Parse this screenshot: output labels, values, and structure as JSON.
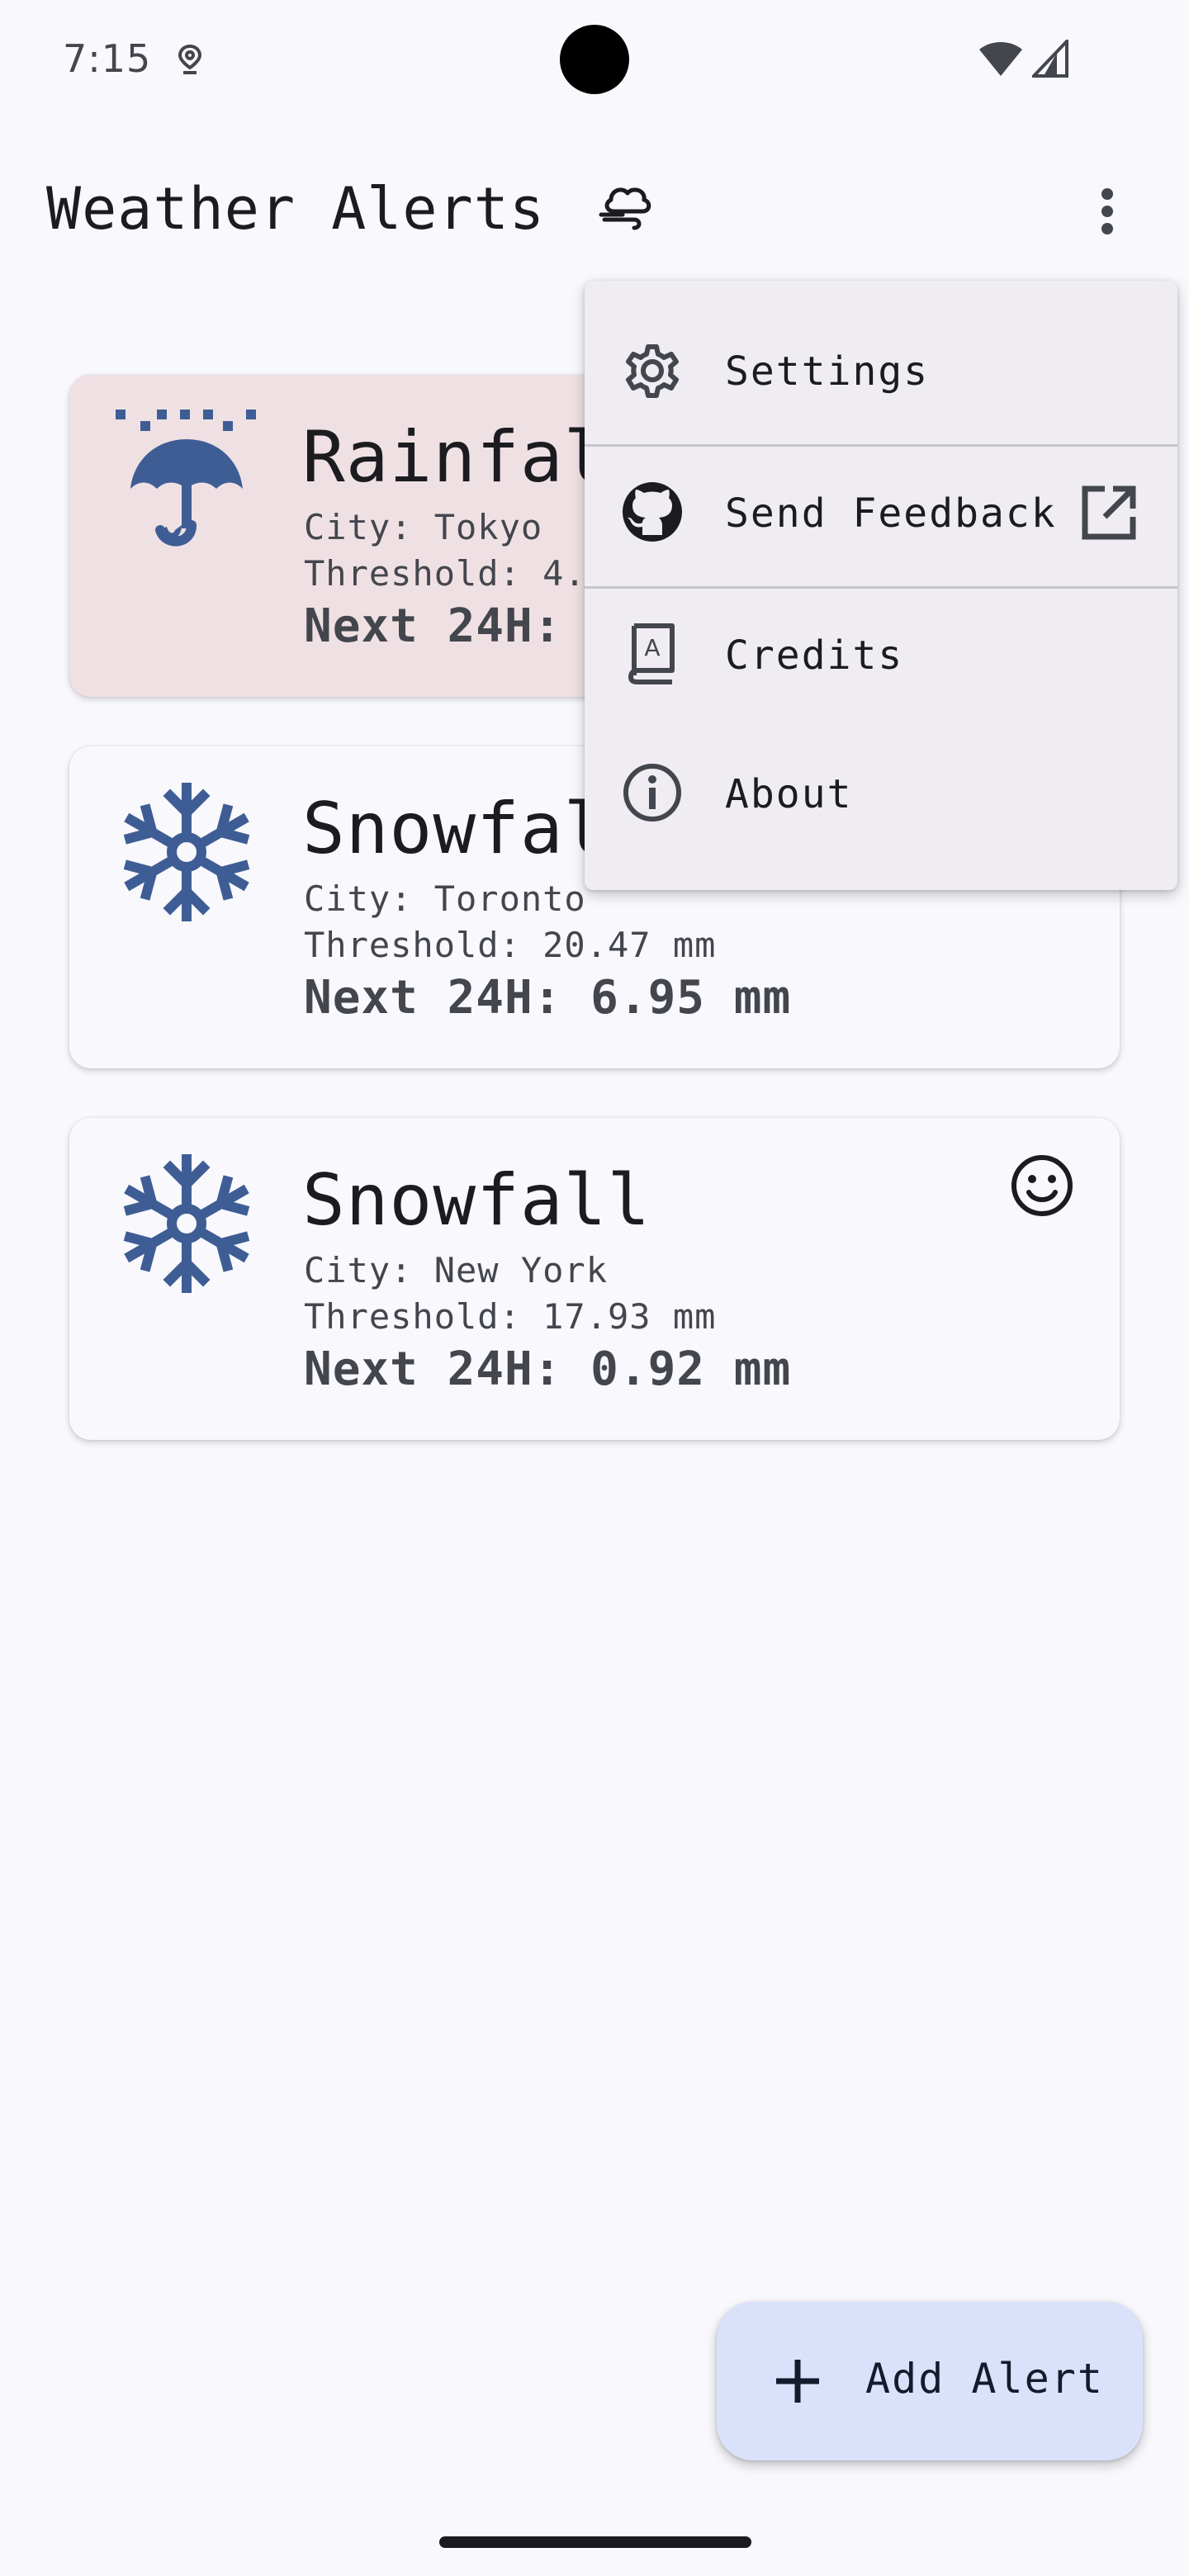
{
  "status_bar": {
    "time": "7:15",
    "icons": [
      "location-pin-icon",
      "wifi-icon",
      "signal-icon"
    ]
  },
  "app_bar": {
    "title": "Weather Alerts",
    "title_icon": "cloud-wind-icon",
    "overflow_icon": "more-vert-icon"
  },
  "alerts": [
    {
      "icon": "umbrella-rain-icon",
      "type": "Rainfall",
      "city": "City: Tokyo",
      "threshold": "Threshold: 4.",
      "next": "Next 24H:",
      "highlighted": true
    },
    {
      "icon": "snowflake-icon",
      "type": "Snowfall",
      "city": "City: Toronto",
      "threshold": "Threshold: 20.47 mm",
      "next": "Next 24H: 6.95 mm",
      "highlighted": false
    },
    {
      "icon": "snowflake-icon",
      "type": "Snowfall",
      "city": "City: New York",
      "threshold": "Threshold: 17.93 mm",
      "next": "Next 24H: 0.92 mm",
      "highlighted": false,
      "status_icon": "smile-icon"
    }
  ],
  "menu": {
    "items": [
      {
        "label": "Settings",
        "icon": "gear-icon"
      },
      {
        "label": "Send Feedback",
        "icon": "github-icon",
        "trailing_icon": "open-external-icon"
      },
      {
        "label": "Credits",
        "icon": "book-icon"
      },
      {
        "label": "About",
        "icon": "info-icon"
      }
    ]
  },
  "fab": {
    "label": "Add Alert",
    "icon": "plus-icon"
  },
  "colors": {
    "background": "#f8f8fd",
    "icon_blue": "#3f5d95",
    "active_card": "#efe1e3",
    "menu_background": "#efedf2",
    "fab_background": "#dae2fb"
  }
}
